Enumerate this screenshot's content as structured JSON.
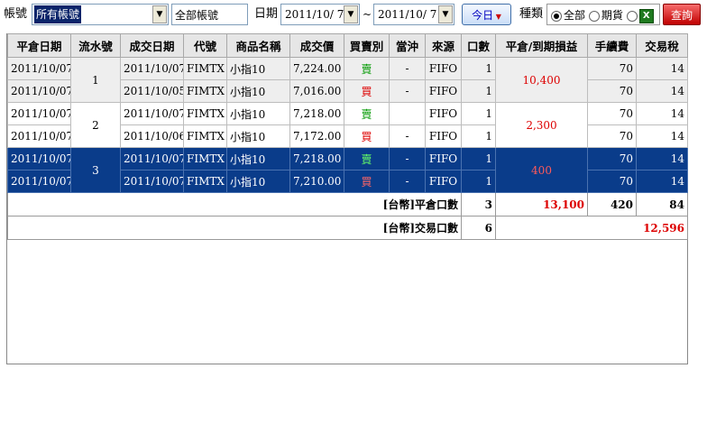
{
  "toolbar": {
    "account_label": "帳號",
    "account_value": "所有帳號",
    "account_name": "全部帳號",
    "date_label": "日期",
    "date_from": "2011/10/ 7",
    "date_sep": "~",
    "date_to": "2011/10/ 7",
    "today_button": "今日",
    "type_label": "種類",
    "radio_all": "全部",
    "radio_futures": "期貨",
    "radio_all_selected": true,
    "excel_icon": "excel-icon",
    "query_button": "查詢"
  },
  "table": {
    "headers": [
      "平倉日期",
      "流水號",
      "成交日期",
      "代號",
      "商品名稱",
      "成交價",
      "買賣別",
      "當沖",
      "來源",
      "口數",
      "平倉/到期損益",
      "手續費",
      "交易稅"
    ],
    "groups": [
      {
        "seq": "1",
        "pl": "10,400",
        "rows": [
          {
            "close_date": "2011/10/07",
            "trade_date": "2011/10/07",
            "code": "FIMTX",
            "product": "小指10",
            "price": "7,224.00",
            "side": "賣",
            "daytrade": "-",
            "source": "FIFO",
            "qty": "1",
            "fee": "70",
            "tax": "14"
          },
          {
            "close_date": "2011/10/07",
            "trade_date": "2011/10/05",
            "code": "FIMTX",
            "product": "小指10",
            "price": "7,016.00",
            "side": "買",
            "daytrade": "-",
            "source": "FIFO",
            "qty": "1",
            "fee": "70",
            "tax": "14"
          }
        ]
      },
      {
        "seq": "2",
        "pl": "2,300",
        "rows": [
          {
            "close_date": "2011/10/07",
            "trade_date": "2011/10/07",
            "code": "FIMTX",
            "product": "小指10",
            "price": "7,218.00",
            "side": "賣",
            "daytrade": "",
            "source": "FIFO",
            "qty": "1",
            "fee": "70",
            "tax": "14"
          },
          {
            "close_date": "2011/10/07",
            "trade_date": "2011/10/06",
            "code": "FIMTX",
            "product": "小指10",
            "price": "7,172.00",
            "side": "買",
            "daytrade": "-",
            "source": "FIFO",
            "qty": "1",
            "fee": "70",
            "tax": "14"
          }
        ]
      },
      {
        "seq": "3",
        "pl": "400",
        "rows": [
          {
            "close_date": "2011/10/07",
            "trade_date": "2011/10/07",
            "code": "FIMTX",
            "product": "小指10",
            "price": "7,218.00",
            "side": "賣",
            "daytrade": "-",
            "source": "FIFO",
            "qty": "1",
            "fee": "70",
            "tax": "14"
          },
          {
            "close_date": "2011/10/07",
            "trade_date": "2011/10/07",
            "code": "FIMTX",
            "product": "小指10",
            "price": "7,210.00",
            "side": "買",
            "daytrade": "-",
            "source": "FIFO",
            "qty": "1",
            "fee": "70",
            "tax": "14"
          }
        ]
      }
    ],
    "summary_close": {
      "label": "[台幣]平倉口數",
      "qty": "3",
      "pl": "13,100",
      "fee": "420",
      "tax": "84"
    },
    "summary_trade": {
      "label": "[台幣]交易口數",
      "qty": "6",
      "net": "12,596"
    }
  },
  "colors": {
    "selected_row": "#0a3c8a",
    "sell": "#009900",
    "buy": "#dd0000"
  }
}
